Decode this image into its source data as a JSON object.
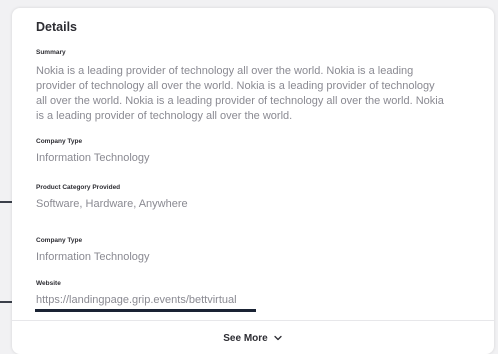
{
  "details": {
    "title": "Details",
    "summary_label": "Summary",
    "summary_text": "Nokia is a leading provider of technology all over the world. Nokia is a leading provider of technology all over the world. Nokia is a leading provider of technology all over the world. Nokia is a leading provider of technology all over the world. Nokia is a leading provider of technology all over the world.",
    "company_type_label": "Company Type",
    "company_type_value": "Information Technology",
    "product_category_label": "Product Category Provided",
    "product_category_value": "Software, Hardware, Anywhere",
    "company_type2_label": "Company Type",
    "company_type2_value": "Information Technology",
    "website_label": "Website",
    "website_value": "https://landingpage.grip.events/bettvirtual",
    "see_more_label": "See More"
  },
  "colors": {
    "card_bg": "#ffffff",
    "page_bg": "#f1f1f3",
    "heading": "#2d2d33",
    "muted_text": "#8a8a92",
    "accent_dark": "#1a2334"
  },
  "icons": {
    "see_more_chevron": "chevron-down-icon"
  }
}
